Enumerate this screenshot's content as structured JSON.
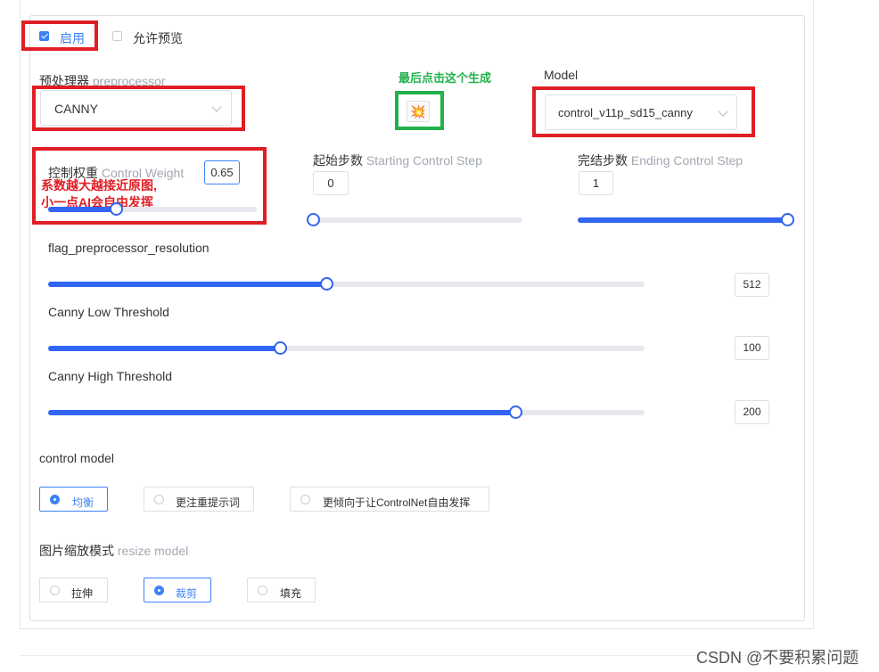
{
  "enable": {
    "label": "启用",
    "checked": true
  },
  "allow_preview": {
    "label": "允许预览",
    "checked": false
  },
  "preprocessor": {
    "label_cn": "预处理器",
    "label_en": "preprocessor",
    "value": "CANNY"
  },
  "generate_annotation": "最后点击这个生成",
  "generate_icon": "💥",
  "model": {
    "label": "Model",
    "value": "control_v11p_sd15_canny"
  },
  "control_weight": {
    "label_cn": "控制权重",
    "label_en": "Control Weight",
    "value": "0.65",
    "min": 0,
    "max": 2,
    "level": 0.65,
    "annotation_line1": "系数越大越接近原图,",
    "annotation_line2": "小一点AI会自由发挥"
  },
  "starting_step": {
    "label_cn": "起始步数",
    "label_en": "Starting Control Step",
    "value": "0",
    "min": 0,
    "max": 1,
    "level": 0
  },
  "ending_step": {
    "label_cn": "完结步数",
    "label_en": "Ending Control Step",
    "value": "1",
    "min": 0,
    "max": 1,
    "level": 1
  },
  "resolution": {
    "label": "flag_preprocessor_resolution",
    "value": "512",
    "min": 64,
    "max": 1024,
    "level": 512
  },
  "low_threshold": {
    "label": "Canny Low Threshold",
    "value": "100",
    "min": 1,
    "max": 255,
    "level": 100
  },
  "high_threshold": {
    "label": "Canny High Threshold",
    "value": "200",
    "min": 1,
    "max": 255,
    "level": 200
  },
  "control_mode": {
    "label": "control model",
    "options": [
      "均衡",
      "更注重提示词",
      "更倾向于让ControlNet自由发挥"
    ],
    "selected": 0
  },
  "resize_mode": {
    "label_cn": "图片缩放模式",
    "label_en": "resize model",
    "options": [
      "拉伸",
      "裁剪",
      "填充"
    ],
    "selected": 1
  },
  "watermark": "CSDN @不要积累问题",
  "colors": {
    "accent": "#3265f0",
    "annotation_red": "#e01e25",
    "annotation_green": "#22b14c"
  }
}
